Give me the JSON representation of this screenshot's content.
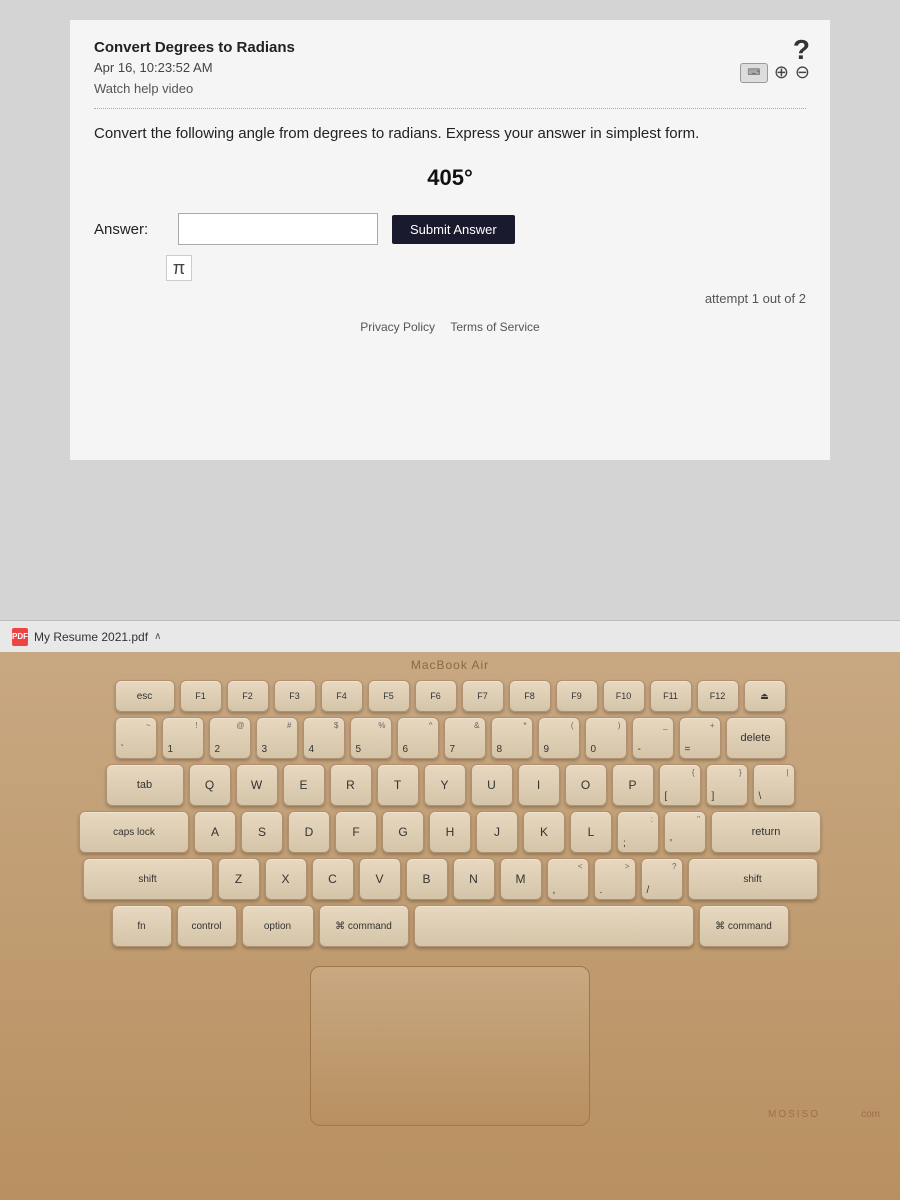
{
  "screen": {
    "problem_title": "Convert Degrees to Radians",
    "problem_date": "Apr 16, 10:23:52 AM",
    "help_video_label": "Watch help video",
    "problem_statement": "Convert the following angle from degrees to radians. Express your answer in simplest form.",
    "angle": "405°",
    "answer_label": "Answer:",
    "answer_placeholder": "",
    "submit_label": "Submit Answer",
    "pi_symbol": "π",
    "attempt_text": "attempt 1 out of 2",
    "footer_privacy": "Privacy Policy",
    "footer_terms": "Terms of Service"
  },
  "bottom_bar": {
    "pdf_name": "My Resume 2021.pdf",
    "chevron": "∧"
  },
  "macbook": {
    "label": "MacBook Air",
    "mosiso": "MOSISO",
    "come": "com"
  },
  "keyboard": {
    "fn_row": [
      "esc",
      "F1",
      "F2",
      "F3",
      "F4",
      "F5",
      "F6",
      "F7",
      "F8",
      "F9",
      "F10",
      "F11",
      "F12"
    ],
    "row1": [
      "`",
      "1",
      "2",
      "3",
      "4",
      "5",
      "6",
      "7",
      "8",
      "9",
      "0",
      "-",
      "=",
      "delete"
    ],
    "row2": [
      "tab",
      "Q",
      "W",
      "E",
      "R",
      "T",
      "Y",
      "U",
      "I",
      "O",
      "P",
      "[",
      "]",
      "\\"
    ],
    "row3": [
      "caps",
      "A",
      "S",
      "D",
      "F",
      "G",
      "H",
      "J",
      "K",
      "L",
      ";",
      "'",
      "return"
    ],
    "row4": [
      "shift",
      "Z",
      "X",
      "C",
      "V",
      "B",
      "N",
      "M",
      ",",
      ".",
      "/",
      "shift"
    ],
    "row5": [
      "fn",
      "control",
      "option",
      "command",
      "",
      "command"
    ]
  }
}
